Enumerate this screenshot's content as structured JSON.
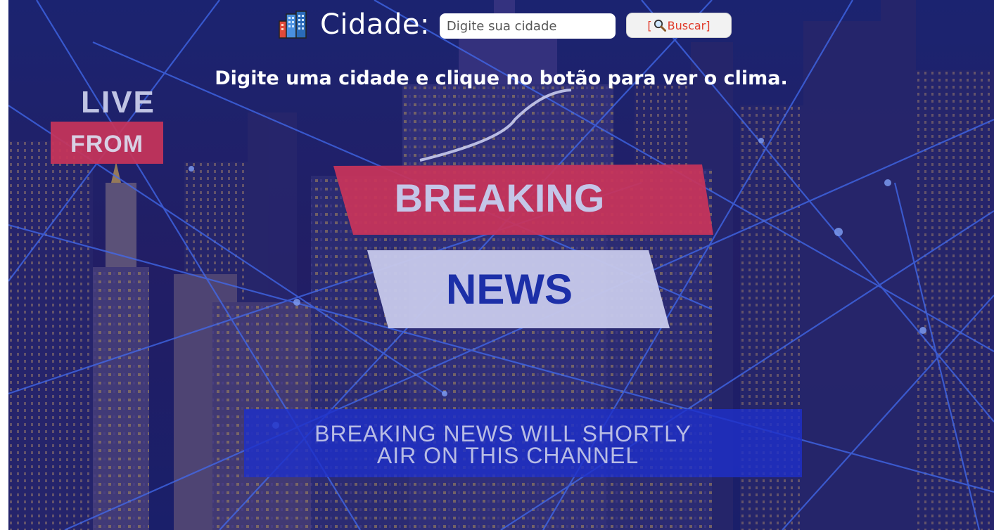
{
  "search": {
    "label": "Cidade:",
    "placeholder": "Digite sua cidade",
    "value": "",
    "button_left_bracket": "[",
    "button_label": "Buscar]",
    "button_icon": "magnifier-icon"
  },
  "message": "Digite uma cidade e clique no botão para ver o clima.",
  "background": {
    "live_text": "LIVE",
    "from_text": "FROM",
    "breaking_text": "BREAKING",
    "news_text": "NEWS",
    "ticker_line1": "BREAKING NEWS WILL SHORTLY",
    "ticker_line2": "AIR ON THIS CHANNEL"
  },
  "colors": {
    "background": "#141a5a",
    "button_text": "#e03a2a",
    "breaking_banner": "#c8345a",
    "news_banner": "#c6c8ea",
    "news_text": "#1c2fa8",
    "ticker": "#1e30c8"
  }
}
